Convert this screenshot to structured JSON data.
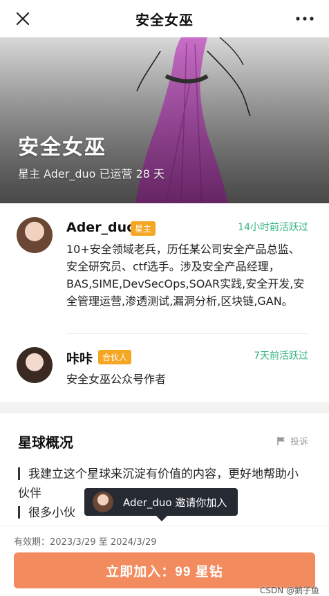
{
  "nav": {
    "title": "安全女巫",
    "close_icon": "close-icon",
    "more_icon": "more-icon"
  },
  "hero": {
    "title": "安全女巫",
    "subtitle": "星主 Ader_duo 已运营 28 天"
  },
  "members": [
    {
      "name": "Ader_duo",
      "role": "星主",
      "role_color": "#f5a623",
      "active": "14小时前活跃过",
      "desc": "10+安全领域老兵，历任某公司安全产品总监、安全研究员、ctf选手。涉及安全产品经理，BAS,SIME,DevSecOps,SOAR实践,安全开发,安全管理运营,渗透测试,漏洞分析,区块链,GAN。"
    },
    {
      "name": "咔咔",
      "role": "合伙人",
      "role_color": "#f5a623",
      "active": "7天前活跃过",
      "desc": "安全女巫公众号作者"
    }
  ],
  "overview": {
    "title": "星球概况",
    "report_label": "投诉",
    "lines": [
      "我建立这个星球来沉淀有价值的内容，更好地帮助小伙伴",
      "很多小伙"
    ]
  },
  "tooltip": {
    "text": "Ader_duo 邀请你加入"
  },
  "footer": {
    "validity": "有效期：2023/3/29 至 2024/3/29",
    "join_label": "立即加入：99 星钻",
    "watermark": "CSDN @鹅子鱼"
  },
  "colors": {
    "accent": "#f28b5e",
    "active_green": "#36b37e",
    "badge": "#f5a623",
    "tooltip_bg": "#252a33"
  }
}
